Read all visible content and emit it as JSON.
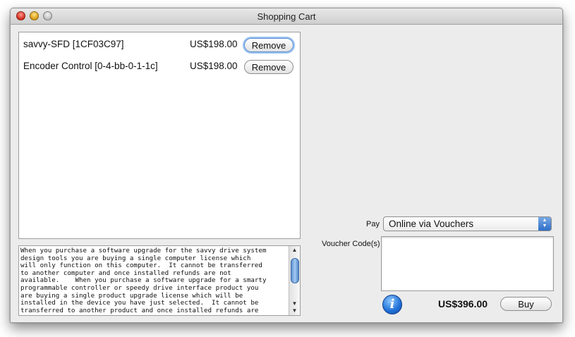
{
  "window": {
    "title": "Shopping Cart"
  },
  "cart": {
    "items": [
      {
        "name": "savvy-SFD [1CF03C97]",
        "price": "US$198.00",
        "remove_label": "Remove"
      },
      {
        "name": "Encoder Control [0-4-bb-0-1-1c]",
        "price": "US$198.00",
        "remove_label": "Remove"
      }
    ]
  },
  "description": {
    "text": "When you purchase a software upgrade for the savvy drive system\ndesign tools you are buying a single computer license which\nwill only function on this computer.  It cannot be transferred\nto another computer and once installed refunds are not\navailable.    When you purchase a software upgrade for a smarty\nprogrammable controller or speedy drive interface product you\nare buying a single product upgrade license which will be\ninstalled in the device you have just selected.  It cannot be\ntransferred to another product and once installed refunds are"
  },
  "payment": {
    "pay_label": "Pay",
    "method": "Online via Vouchers",
    "voucher_label": "Voucher Code(s)",
    "voucher_value": "",
    "total": "US$396.00",
    "buy_label": "Buy"
  },
  "colors": {
    "accent": "#3f7fd6",
    "window_bg": "#ececec"
  }
}
